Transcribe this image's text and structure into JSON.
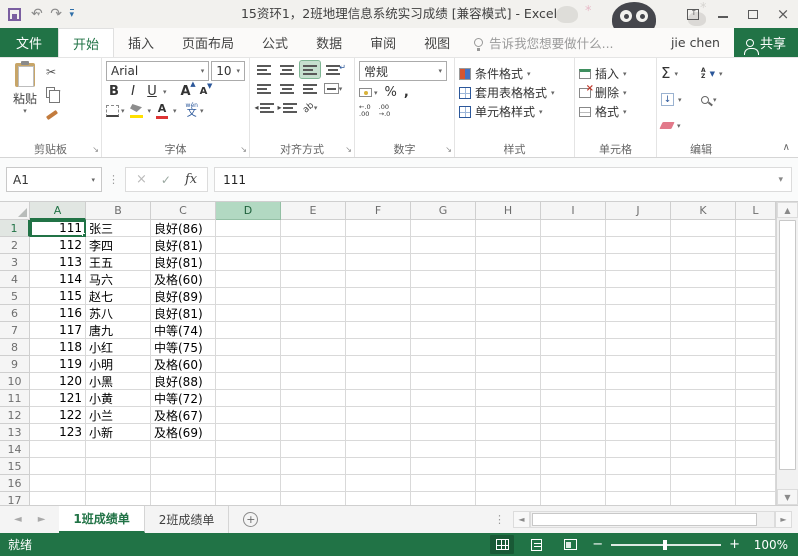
{
  "titlebar": {
    "title": "15资环1，2班地理信息系统实习成绩  [兼容模式] - Excel"
  },
  "tabs": {
    "file": "文件",
    "items": [
      "开始",
      "插入",
      "页面布局",
      "公式",
      "数据",
      "审阅",
      "视图"
    ],
    "tell_me": "告诉我您想要做什么...",
    "user": "jie chen",
    "share": "共享"
  },
  "ribbon": {
    "clipboard": {
      "label": "剪贴板",
      "paste": "粘贴",
      "cut_icon": "✂"
    },
    "font": {
      "label": "字体",
      "font_name": "Arial",
      "font_size": "10",
      "bold": "B",
      "italic": "I",
      "underline": "U",
      "grow": "A",
      "shrink": "A",
      "color_a": "A",
      "phonetic_top": "wén",
      "phonetic_bottom": "文"
    },
    "alignment": {
      "label": "对齐方式",
      "orientation": "ab",
      "wrap_mark": "↵",
      "indent_left": "◂",
      "indent_right": "▸"
    },
    "number": {
      "label": "数字",
      "format": "常规",
      "percent": "%",
      "comma": ",",
      "dec_inc_a": "←.0",
      "dec_inc_b": ".00",
      "dec_dec_a": ".00",
      "dec_dec_b": "→.0"
    },
    "styles": {
      "label": "样式",
      "items": [
        "条件格式",
        "套用表格格式",
        "单元格样式"
      ]
    },
    "cells": {
      "label": "单元格",
      "items": [
        "插入",
        "删除",
        "格式"
      ]
    },
    "editing": {
      "label": "编辑",
      "autosum": "Σ",
      "fill_arrow": "↓",
      "sort_a": "A",
      "sort_z": "Z",
      "sort_f": "▼"
    }
  },
  "formula_bar": {
    "name_box": "A1",
    "fx": "fx",
    "value": "111"
  },
  "grid": {
    "columns": [
      "A",
      "B",
      "C",
      "D",
      "E",
      "F",
      "G",
      "H",
      "I",
      "J",
      "K",
      "L"
    ],
    "selected_column": "A",
    "selected_row": 1,
    "highlighted_column": "D",
    "records": [
      {
        "id": "111",
        "name": "张三",
        "grade": "良好(86)"
      },
      {
        "id": "112",
        "name": "李四",
        "grade": "良好(81)"
      },
      {
        "id": "113",
        "name": "王五",
        "grade": "良好(81)"
      },
      {
        "id": "114",
        "name": "马六",
        "grade": "及格(60)"
      },
      {
        "id": "115",
        "name": "赵七",
        "grade": "良好(89)"
      },
      {
        "id": "116",
        "name": "苏八",
        "grade": "良好(81)"
      },
      {
        "id": "117",
        "name": "唐九",
        "grade": "中等(74)"
      },
      {
        "id": "118",
        "name": "小红",
        "grade": "中等(75)"
      },
      {
        "id": "119",
        "name": "小明",
        "grade": "及格(60)"
      },
      {
        "id": "120",
        "name": "小黑",
        "grade": "良好(88)"
      },
      {
        "id": "121",
        "name": "小黄",
        "grade": "中等(72)"
      },
      {
        "id": "122",
        "name": "小兰",
        "grade": "及格(67)"
      },
      {
        "id": "123",
        "name": "小新",
        "grade": "及格(69)"
      }
    ]
  },
  "sheet_bar": {
    "tabs": [
      {
        "label": "1班成绩单",
        "active": true
      },
      {
        "label": "2班成绩单",
        "active": false
      }
    ],
    "add": "+"
  },
  "status_bar": {
    "status": "就绪",
    "zoom": "100%"
  },
  "colors": {
    "accent_green": "#217346",
    "selection_green": "#217346",
    "highlight_header": "#b2d9c2"
  }
}
